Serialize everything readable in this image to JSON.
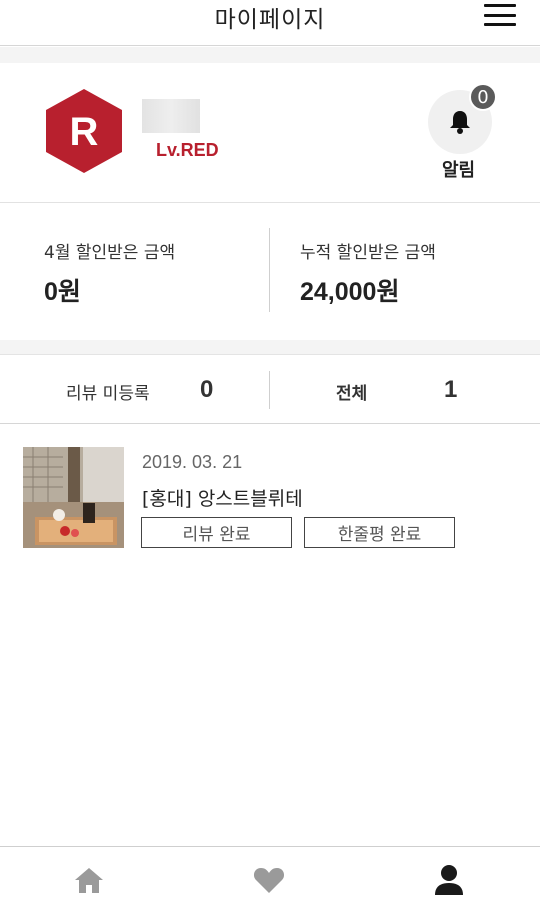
{
  "header": {
    "title": "마이페이지",
    "menu_icon": "hamburger-menu-icon"
  },
  "profile": {
    "badge_letter": "R",
    "level": "Lv.RED",
    "alarm": {
      "count": "0",
      "label": "알림",
      "icon": "bell-icon"
    }
  },
  "discount": {
    "month_label": "4월 할인받은 금액",
    "month_value": "0원",
    "total_label": "누적 할인받은 금액",
    "total_value": "24,000원"
  },
  "reviews": {
    "unregistered_label": "리뷰 미등록",
    "unregistered_count": "0",
    "all_label": "전체",
    "all_count": "1"
  },
  "items": [
    {
      "date": "2019. 03. 21",
      "name": "[홍대] 앙스트블뤼테",
      "status1": "리뷰 완료",
      "status2": "한줄평 완료"
    }
  ],
  "nav": {
    "home_icon": "home-icon",
    "heart_icon": "heart-icon",
    "user_icon": "user-icon",
    "active": "user"
  },
  "colors": {
    "brand_red": "#b8202e",
    "badge_bg": "#5a5a5a"
  }
}
